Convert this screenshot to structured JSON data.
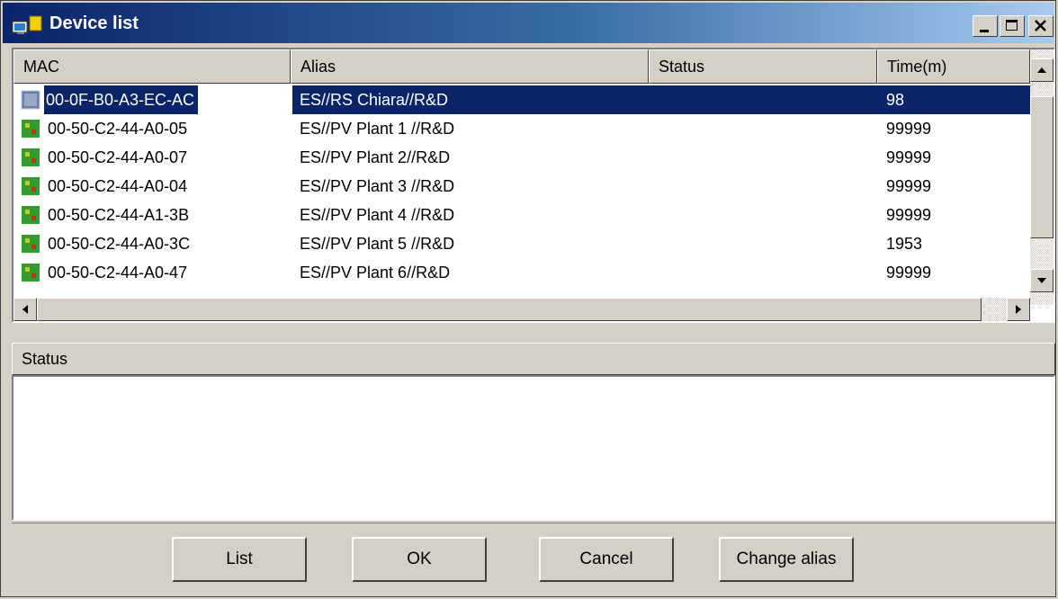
{
  "window": {
    "title": "Device list"
  },
  "columns": [
    {
      "label": "MAC"
    },
    {
      "label": "Alias"
    },
    {
      "label": "Status"
    },
    {
      "label": "Time(m)"
    }
  ],
  "devices": [
    {
      "mac": "00-0F-B0-A3-EC-AC",
      "alias": "ES//RS Chiara//R&D",
      "status": "",
      "time": "98",
      "selected": true,
      "icon": "generic-device-icon"
    },
    {
      "mac": "00-50-C2-44-A0-05",
      "alias": "ES//PV Plant 1 //R&D",
      "status": "",
      "time": "99999",
      "icon": "green-device-icon"
    },
    {
      "mac": "00-50-C2-44-A0-07",
      "alias": "ES//PV Plant 2//R&D",
      "status": "",
      "time": "99999",
      "icon": "green-device-icon"
    },
    {
      "mac": "00-50-C2-44-A0-04",
      "alias": "ES//PV Plant 3 //R&D",
      "status": "",
      "time": "99999",
      "icon": "green-device-icon"
    },
    {
      "mac": "00-50-C2-44-A1-3B",
      "alias": "ES//PV Plant 4 //R&D",
      "status": "",
      "time": "99999",
      "icon": "green-device-icon"
    },
    {
      "mac": "00-50-C2-44-A0-3C",
      "alias": "ES//PV Plant 5 //R&D",
      "status": "",
      "time": "1953",
      "icon": "green-device-icon"
    },
    {
      "mac": "00-50-C2-44-A0-47",
      "alias": "ES//PV Plant 6//R&D",
      "status": "",
      "time": "99999",
      "icon": "green-device-icon"
    }
  ],
  "status_panel": {
    "label": "Status",
    "text": ""
  },
  "buttons": {
    "list": "List",
    "ok": "OK",
    "cancel": "Cancel",
    "change_alias": "Change alias"
  },
  "colors": {
    "title_start": "#0a246a",
    "title_end": "#a6caf0",
    "selection": "#0a246a",
    "face": "#d4d0c8",
    "device_green": "#2e9e2e"
  }
}
